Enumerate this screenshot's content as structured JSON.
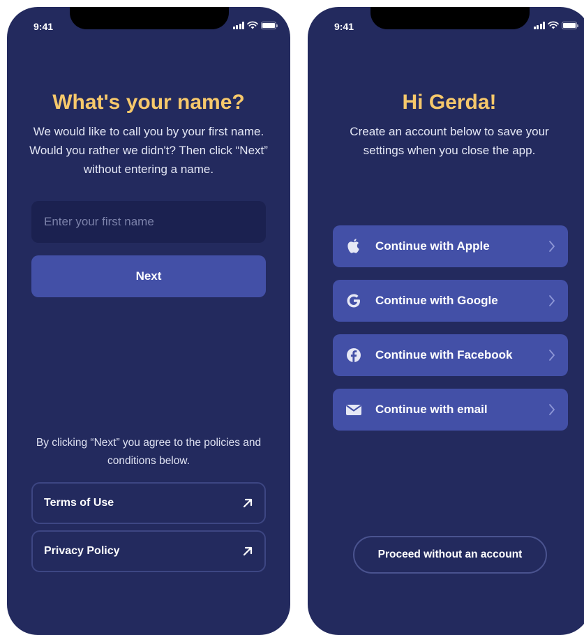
{
  "status_bar": {
    "time": "9:41"
  },
  "name_screen": {
    "title": "What's your name?",
    "subtitle": "We would like to call you by your first name. Would you rather we didn't? Then click “Next” without entering a name.",
    "input_placeholder": "Enter your first name",
    "input_value": "",
    "next_label": "Next",
    "agreement_text": "By clicking “Next” you agree to the policies and conditions below.",
    "terms_label": "Terms of Use",
    "privacy_label": "Privacy Policy"
  },
  "account_screen": {
    "title": "Hi Gerda!",
    "subtitle": "Create an account below to save your settings when you close the app.",
    "buttons": [
      {
        "label": "Continue with Apple",
        "icon": "apple-icon"
      },
      {
        "label": "Continue with Google",
        "icon": "google-icon"
      },
      {
        "label": "Continue with Facebook",
        "icon": "facebook-icon"
      },
      {
        "label": "Continue with email",
        "icon": "mail-icon"
      }
    ],
    "proceed_label": "Proceed without an account"
  },
  "colors": {
    "background": "#232a5e",
    "button": "#4350a7",
    "input": "#1b2150",
    "title": "#f6c86b",
    "outline": "#3d4683"
  }
}
